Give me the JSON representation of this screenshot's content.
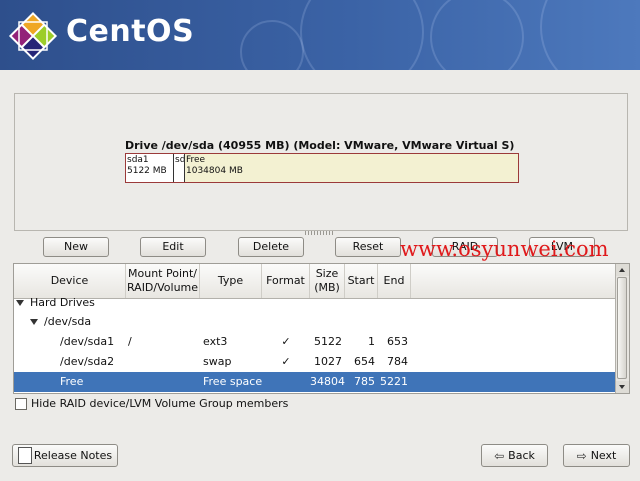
{
  "brand": {
    "name": "CentOS"
  },
  "drive": {
    "title": "Drive /dev/sda (40955 MB) (Model: VMware, VMware Virtual S)",
    "segments": [
      {
        "name": "sda1",
        "size": "5122 MB"
      },
      {
        "name": "sd",
        "size": ""
      },
      {
        "name": "Free",
        "size": "1034804 MB"
      }
    ]
  },
  "buttons": {
    "new": "New",
    "edit": "Edit",
    "delete": "Delete",
    "reset": "Reset",
    "raid": "RAID",
    "lvm": "LVM"
  },
  "watermark": "www.osyunwei.com",
  "table": {
    "headers": {
      "device": "Device",
      "mount": "Mount Point/\nRAID/Volume",
      "type": "Type",
      "format": "Format",
      "size": "Size\n(MB)",
      "start": "Start",
      "end": "End"
    },
    "groups": {
      "hard_drives": "Hard Drives",
      "sda": "/dev/sda"
    },
    "rows": [
      {
        "device": "/dev/sda1",
        "mount": "/",
        "type": "ext3",
        "format": "✓",
        "size": "5122",
        "start": "1",
        "end": "653"
      },
      {
        "device": "/dev/sda2",
        "mount": "",
        "type": "swap",
        "format": "✓",
        "size": "1027",
        "start": "654",
        "end": "784"
      },
      {
        "device": "Free",
        "mount": "",
        "type": "Free space",
        "format": "",
        "size": "34804",
        "start": "785",
        "end": "5221"
      }
    ]
  },
  "hide_option": {
    "label": "Hide RAID device/LVM Volume Group members"
  },
  "footer": {
    "release_notes": "Release Notes",
    "back": "Back",
    "next": "Next"
  },
  "colors": {
    "banner": "#3b63a6",
    "selected_row": "#3f74b8",
    "watermark": "#e0191b"
  }
}
